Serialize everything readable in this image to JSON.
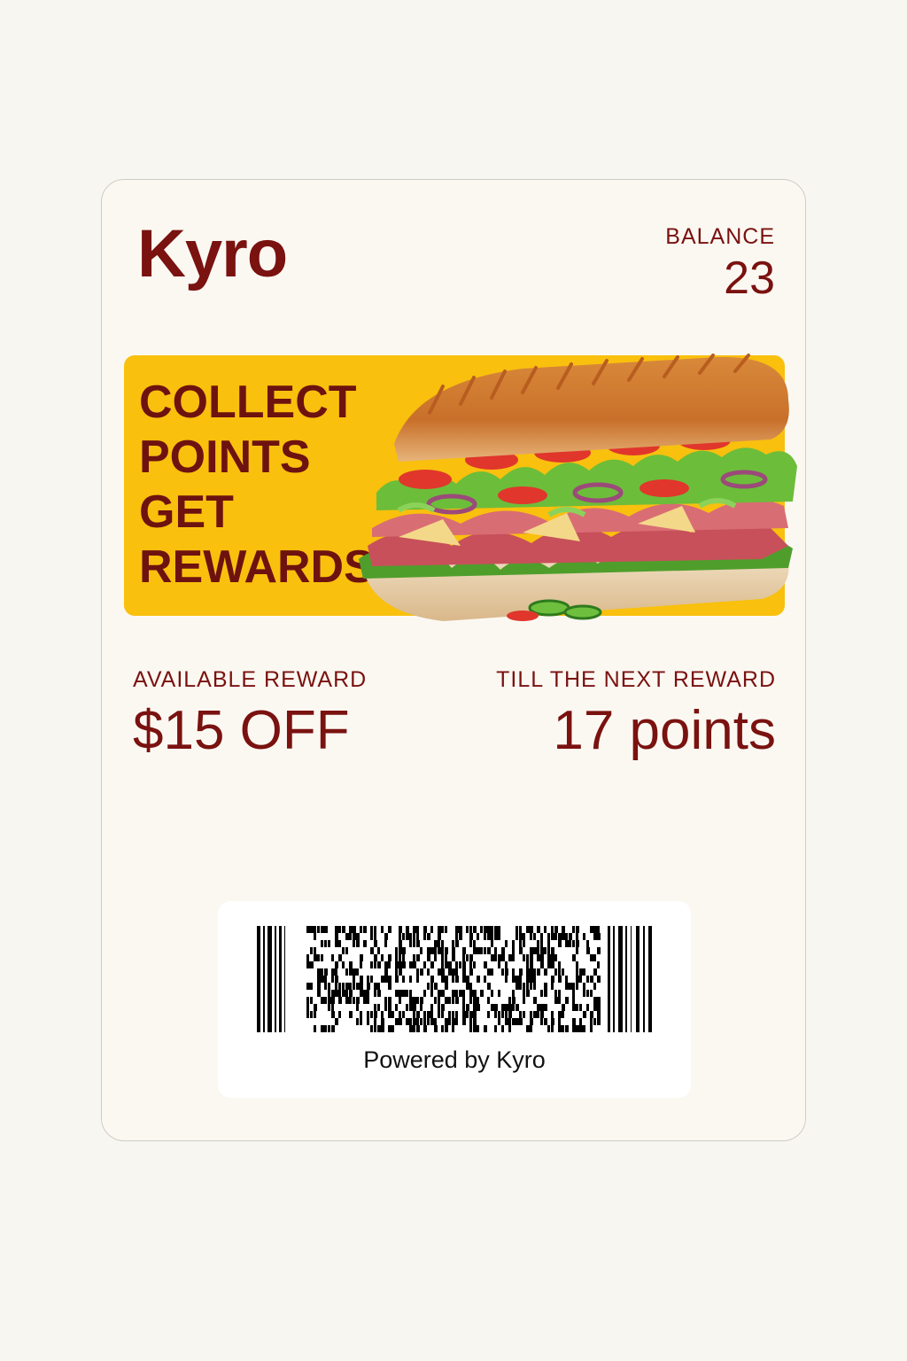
{
  "card": {
    "brand": "Kyro",
    "balance_label": "BALANCE",
    "balance_value": "23"
  },
  "banner": {
    "lines": [
      "COLLECT",
      "POINTS",
      "GET",
      "REWARDS"
    ],
    "background_color": "#f9c00d",
    "text_color": "#6e1210",
    "image": "sub-sandwich-illustration"
  },
  "rewards": {
    "available_label": "AVAILABLE REWARD",
    "available_value": "$15 OFF",
    "next_label": "TILL THE NEXT REWARD",
    "next_value": "17 points"
  },
  "barcode": {
    "powered_by": "Powered by Kyro"
  },
  "colors": {
    "accent": "#7a1210",
    "page_background": "#f8f6f1",
    "card_background": "#fbf8f2"
  }
}
